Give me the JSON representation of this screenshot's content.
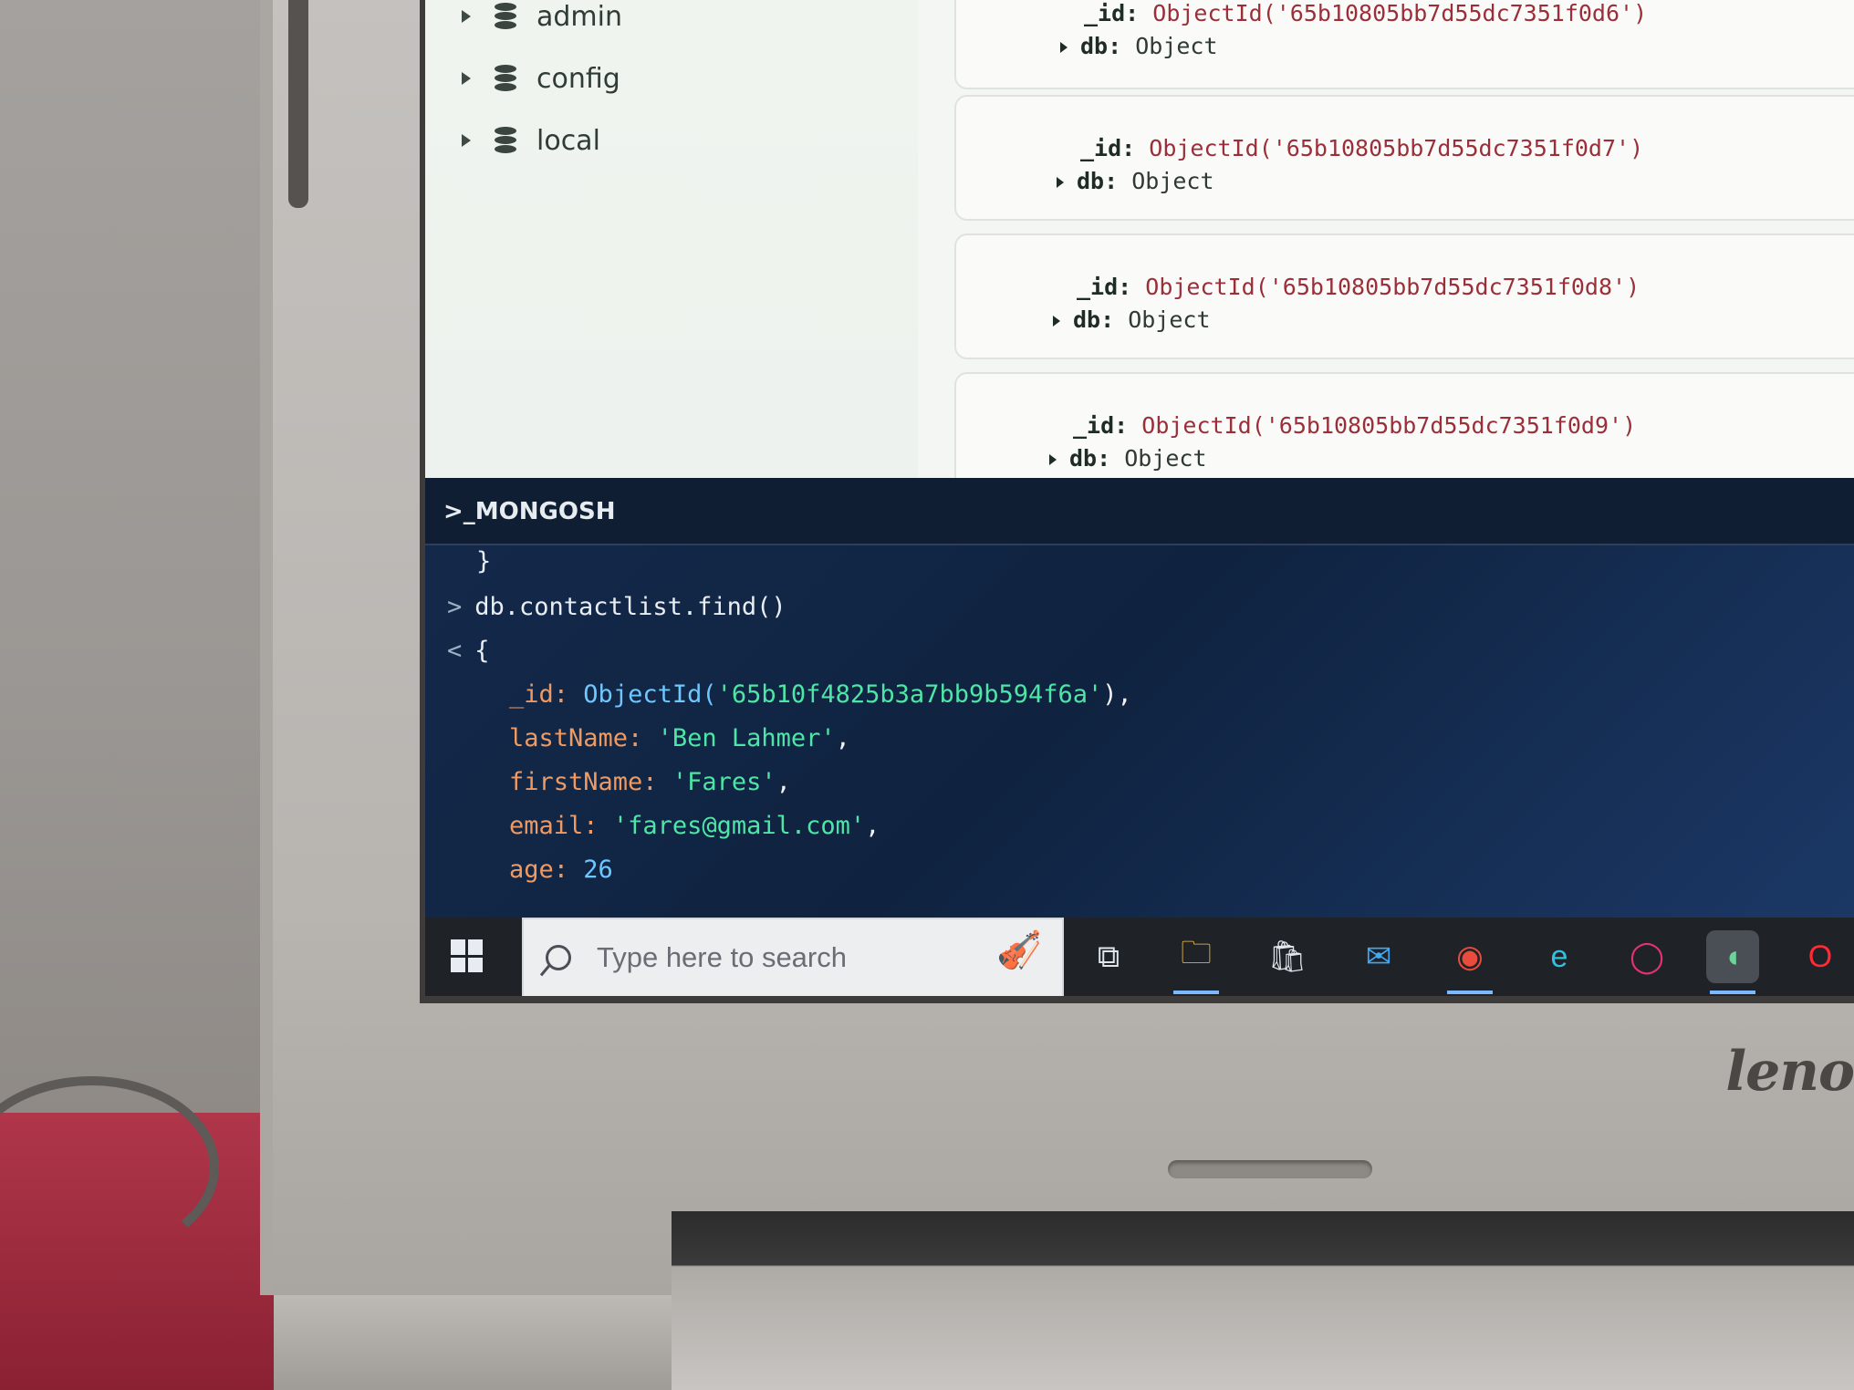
{
  "sidebar": {
    "databases": [
      {
        "label": "admin"
      },
      {
        "label": "config"
      },
      {
        "label": "local"
      }
    ]
  },
  "documents": [
    {
      "id_key": "_id:",
      "id_value": "ObjectId('65b10805bb7d55dc7351f0d6')",
      "db_key": "db:",
      "db_value": "Object"
    },
    {
      "id_key": "_id:",
      "id_value": "ObjectId('65b10805bb7d55dc7351f0d7')",
      "db_key": "db:",
      "db_value": "Object"
    },
    {
      "id_key": "_id:",
      "id_value": "ObjectId('65b10805bb7d55dc7351f0d8')",
      "db_key": "db:",
      "db_value": "Object"
    },
    {
      "id_key": "_id:",
      "id_value": "ObjectId('65b10805bb7d55dc7351f0d9')",
      "db_key": "db:",
      "db_value": "Object"
    }
  ],
  "mongosh": {
    "title": ">_MONGOSH",
    "line_close": "}",
    "prompt_in": ">",
    "command": "db.contactlist.find()",
    "prompt_out": "<",
    "open_brace": "{",
    "fields": [
      {
        "key": "_id:",
        "fn": "ObjectId(",
        "value": "'65b10f4825b3a7bb9b594f6a'",
        "tail": "),",
        "type": "oid"
      },
      {
        "key": "lastName:",
        "value": "'Ben Lahmer'",
        "tail": ",",
        "type": "string"
      },
      {
        "key": "firstName:",
        "value": "'Fares'",
        "tail": ",",
        "type": "string"
      },
      {
        "key": "email:",
        "value": "'fares@gmail.com'",
        "tail": ",",
        "type": "string"
      },
      {
        "key": "age:",
        "value": "26",
        "tail": "",
        "type": "number"
      }
    ]
  },
  "taskbar": {
    "search_placeholder": "Type here to search",
    "icons": [
      "task-view-icon",
      "file-explorer-icon",
      "microsoft-store-icon",
      "mail-icon",
      "chrome-icon",
      "edge-icon",
      "opera-gx-icon",
      "mongodb-compass-icon",
      "opera-icon"
    ]
  },
  "hardware": {
    "brand": "leno"
  },
  "colors": {
    "shell_bg": "#14284a",
    "key": "#f09a63",
    "string": "#4ee6a6",
    "number": "#6fc7ff",
    "oid_value": "#9a2f3a"
  }
}
